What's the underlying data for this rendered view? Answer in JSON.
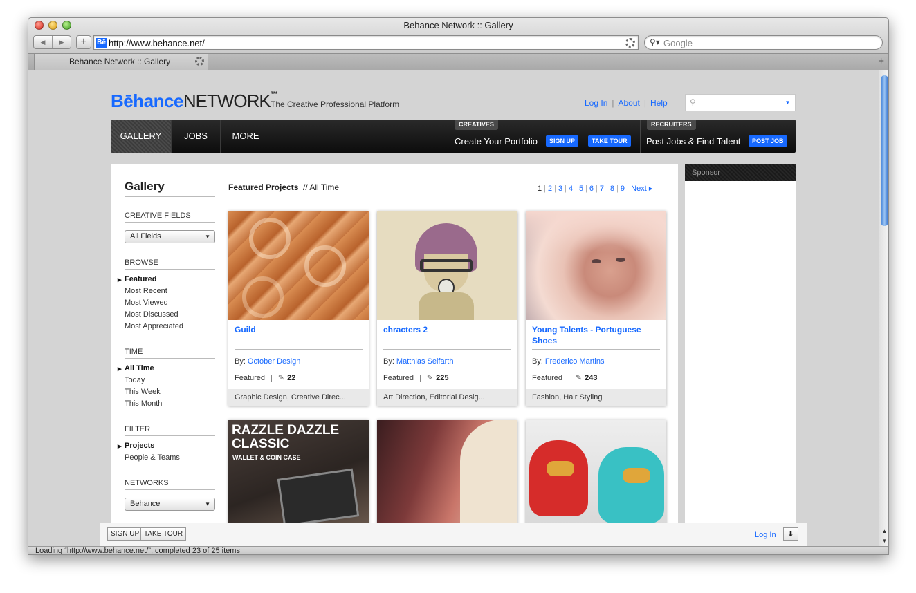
{
  "window": {
    "title": "Behance Network :: Gallery"
  },
  "toolbar": {
    "back_icon": "back-arrow-icon",
    "forward_icon": "forward-arrow-icon",
    "add_bookmark_label": "+",
    "url": "http://www.behance.net/",
    "favicon_text": "Bē",
    "search_placeholder": "Google",
    "search_icon": "⚲▾"
  },
  "tab": {
    "title": "Behance Network :: Gallery",
    "new_tab_label": "+"
  },
  "status": {
    "text": "Loading “http://www.behance.net/”, completed 23 of 25 items"
  },
  "site": {
    "logo_be": "Bēhance",
    "logo_net": "NETWORK",
    "logo_tm": "™",
    "tagline": "The Creative Professional Platform",
    "links": {
      "login": "Log In",
      "about": "About",
      "help": "Help"
    }
  },
  "nav": {
    "items": [
      "GALLERY",
      "JOBS",
      "MORE"
    ],
    "creatives_tag": "CREATIVES",
    "creatives_text": "Create Your Portfolio",
    "signup": "SIGN UP",
    "take_tour": "TAKE TOUR",
    "recruiters_tag": "RECRUITERS",
    "recruiters_text": "Post Jobs & Find Talent",
    "post_job": "POST JOB"
  },
  "sidebar": {
    "title": "Gallery",
    "creative_fields_head": "CREATIVE FIELDS",
    "creative_fields_value": "All Fields",
    "browse_head": "BROWSE",
    "browse": [
      "Featured",
      "Most Recent",
      "Most Viewed",
      "Most Discussed",
      "Most Appreciated"
    ],
    "time_head": "TIME",
    "time": [
      "All Time",
      "Today",
      "This Week",
      "This Month"
    ],
    "filter_head": "FILTER",
    "filter": [
      "Projects",
      "People & Teams"
    ],
    "networks_head": "NETWORKS",
    "networks_value": "Behance"
  },
  "featured": {
    "title": "Featured Projects",
    "subtitle": "// All Time",
    "pages": [
      "1",
      "2",
      "3",
      "4",
      "5",
      "6",
      "7",
      "8",
      "9"
    ],
    "next": "Next ▸"
  },
  "cards": [
    {
      "title": "Guild",
      "by_label": "By:",
      "author": "October Design",
      "featured": "Featured",
      "count": "22",
      "fields": "Graphic Design, Creative Direc..."
    },
    {
      "title": "chracters 2",
      "by_label": "By:",
      "author": "Matthias Seifarth",
      "featured": "Featured",
      "count": "225",
      "fields": "Art Direction, Editorial Desig..."
    },
    {
      "title": "Young Talents - Portuguese Shoes",
      "by_label": "By:",
      "author": "Frederico Martins",
      "featured": "Featured",
      "count": "243",
      "fields": "Fashion, Hair Styling"
    },
    {
      "poster_title": "RAZZLE DAZZLE CLASSIC",
      "poster_sub": "WALLET & COIN CASE"
    }
  ],
  "sponsor": {
    "label": "Sponsor"
  },
  "bottombar": {
    "signup": "SIGN UP",
    "take_tour": "TAKE TOUR",
    "login": "Log In",
    "download_icon": "⬇"
  },
  "colors": {
    "accent": "#1769ff",
    "nav_bg": "#111111"
  }
}
